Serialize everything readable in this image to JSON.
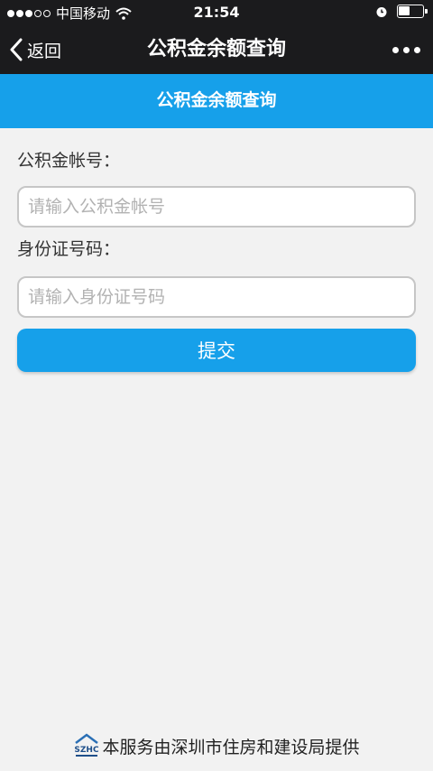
{
  "status_bar": {
    "carrier": "中国移动",
    "time": "21:54",
    "signal_dots_filled": 3,
    "signal_dots_total": 5
  },
  "nav": {
    "back_label": "返回",
    "title": "公积金余额查询",
    "more_icon": "more-dots-icon"
  },
  "header": {
    "title": "公积金余额查询"
  },
  "form": {
    "account_label": "公积金帐号：",
    "account_placeholder": "请输入公积金帐号",
    "account_value": "",
    "id_label": "身份证号码：",
    "id_placeholder": "请输入身份证号码",
    "id_value": "",
    "submit_label": "提交"
  },
  "footer": {
    "logo_text": "SZHC",
    "text": "本服务由深圳市住房和建设局提供"
  },
  "colors": {
    "accent": "#16a0ea",
    "bar_bg": "#1b1b1d",
    "page_bg": "#f2f2f2"
  }
}
